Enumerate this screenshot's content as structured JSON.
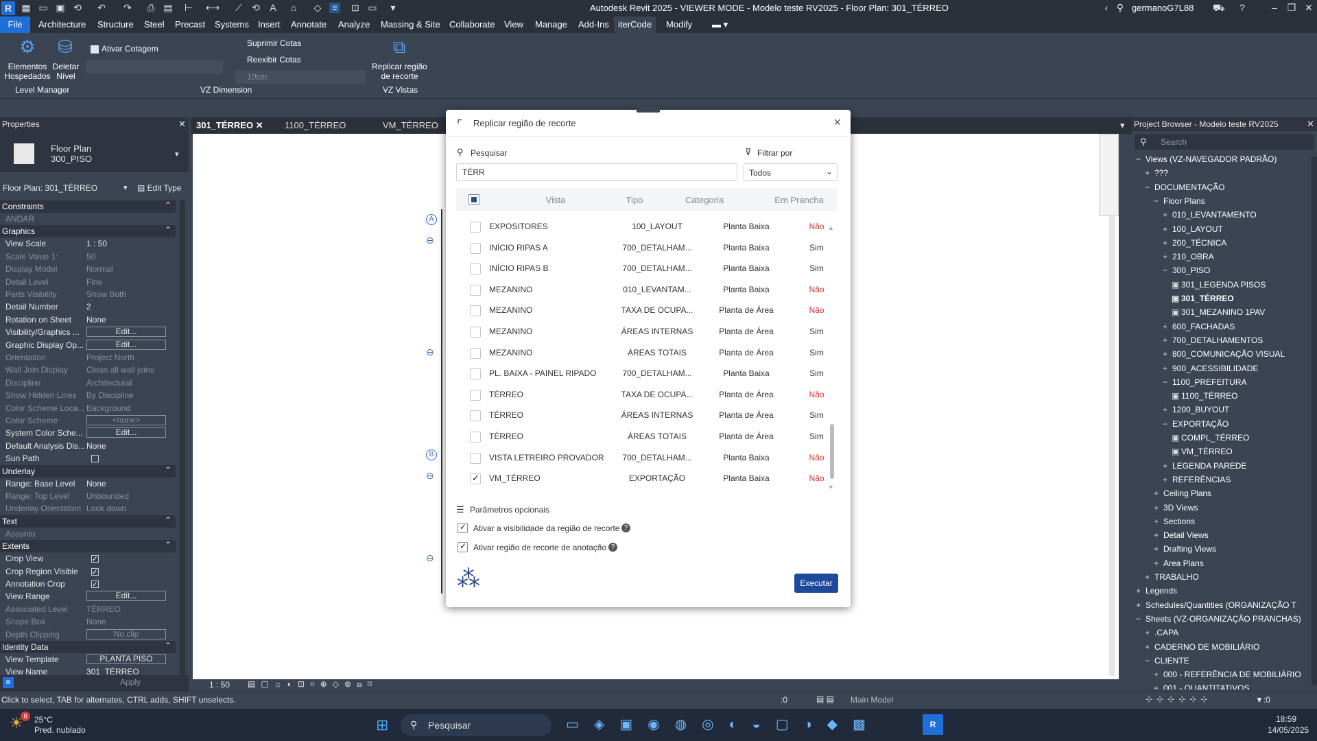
{
  "app": {
    "title": "Autodesk Revit 2025 - VIEWER MODE - Modelo teste RV2025 - Floor Plan: 301_TÉRREO",
    "user": "germanoG7L88"
  },
  "menu": [
    "File",
    "Architecture",
    "Structure",
    "Steel",
    "Precast",
    "Systems",
    "Insert",
    "Annotate",
    "Analyze",
    "Massing & Site",
    "Collaborate",
    "View",
    "Manage",
    "Add-Ins",
    "iterCode",
    "Modify"
  ],
  "ribbon": {
    "elementos": "Elementos\nHospedados",
    "deletar": "Deletar\nNível",
    "ativar": "Ativar Cotagem",
    "suprimir": "Suprimir Cotas",
    "reexibir": "Reexibir Cotas",
    "size": "10cm",
    "replicar": "Replicar região\nde recorte",
    "groups": {
      "level": "Level Manager",
      "dim": "VZ Dimension",
      "vistas": "VZ Vistas"
    }
  },
  "properties": {
    "title": "Properties",
    "type": "Floor Plan",
    "subtype": "300_PISO",
    "selector": "Floor Plan: 301_TÉRREO",
    "edit_type": "Edit Type",
    "apply": "Apply",
    "rows": [
      {
        "k": "Constraints",
        "section": true
      },
      {
        "k": "ANDAR",
        "v": "",
        "dim": true
      },
      {
        "k": "Graphics",
        "section": true
      },
      {
        "k": "View Scale",
        "v": "1 : 50"
      },
      {
        "k": "Scale Value    1:",
        "v": "50",
        "dim": true
      },
      {
        "k": "Display Model",
        "v": "Normal",
        "dim": true
      },
      {
        "k": "Detail Level",
        "v": "Fine",
        "dim": true
      },
      {
        "k": "Parts Visibility",
        "v": "Show Both",
        "dim": true
      },
      {
        "k": "Detail Number",
        "v": "2"
      },
      {
        "k": "Rotation on Sheet",
        "v": "None"
      },
      {
        "k": "Visibility/Graphics ...",
        "v": "Edit...",
        "btn": true
      },
      {
        "k": "Graphic Display Op...",
        "v": "Edit...",
        "btn": true
      },
      {
        "k": "Orientation",
        "v": "Project North",
        "dim": true
      },
      {
        "k": "Wall Join Display",
        "v": "Clean all wall joins",
        "dim": true
      },
      {
        "k": "Discipline",
        "v": "Architectural",
        "dim": true
      },
      {
        "k": "Show Hidden Lines",
        "v": "By Discipline",
        "dim": true
      },
      {
        "k": "Color Scheme Loca...",
        "v": "Background",
        "dim": true
      },
      {
        "k": "Color Scheme",
        "v": "<none>",
        "btn": true,
        "dim": true
      },
      {
        "k": "System Color Sche...",
        "v": "Edit...",
        "btn": true
      },
      {
        "k": "Default Analysis Dis...",
        "v": "None"
      },
      {
        "k": "Sun Path",
        "v": "",
        "cb": false
      },
      {
        "k": "Underlay",
        "section": true
      },
      {
        "k": "Range: Base Level",
        "v": "None"
      },
      {
        "k": "Range: Top Level",
        "v": "Unbounded",
        "dim": true
      },
      {
        "k": "Underlay Orientation",
        "v": "Look down",
        "dim": true
      },
      {
        "k": "Text",
        "section": true
      },
      {
        "k": "Assunto",
        "v": "",
        "dim": true
      },
      {
        "k": "Extents",
        "section": true
      },
      {
        "k": "Crop View",
        "v": "",
        "cb": true
      },
      {
        "k": "Crop Region Visible",
        "v": "",
        "cb": true
      },
      {
        "k": "Annotation Crop",
        "v": "",
        "cb": true
      },
      {
        "k": "View Range",
        "v": "Edit...",
        "btn": true
      },
      {
        "k": "Associated Level",
        "v": "TÉRREO",
        "dim": true
      },
      {
        "k": "Scope Box",
        "v": "None",
        "dim": true
      },
      {
        "k": "Depth Clipping",
        "v": "No clip",
        "btn": true,
        "dim": true
      },
      {
        "k": "Identity Data",
        "section": true
      },
      {
        "k": "View Template",
        "v": "PLANTA PISO",
        "btn": true
      },
      {
        "k": "View Name",
        "v": "301_TÉRREO"
      }
    ]
  },
  "tabs": [
    "301_TÉRREO",
    "1100_TÉRREO",
    "VM_TÉRREO"
  ],
  "dialog": {
    "title": "Replicar região de recorte",
    "search_label": "Pesquisar",
    "search_value": "TÉRR",
    "filter_label": "Filtrar por",
    "filter_value": "Todos",
    "headers": [
      "Vista",
      "Tipo",
      "Categoria",
      "Em Prancha"
    ],
    "rows": [
      {
        "vista": "EXPOSITORES",
        "tipo": "100_LAYOUT",
        "cat": "Planta Baixa",
        "pr": "Não",
        "checked": false
      },
      {
        "vista": "INÍCIO RIPAS A",
        "tipo": "700_DETALHAM...",
        "cat": "Planta Baixa",
        "pr": "Sim",
        "checked": false
      },
      {
        "vista": "INÍCIO RIPAS B",
        "tipo": "700_DETALHAM...",
        "cat": "Planta Baixa",
        "pr": "Sim",
        "checked": false
      },
      {
        "vista": "MEZANINO",
        "tipo": "010_LEVANTAM...",
        "cat": "Planta Baixa",
        "pr": "Não",
        "checked": false
      },
      {
        "vista": "MEZANINO",
        "tipo": "TAXA DE OCUPA...",
        "cat": "Planta de Área",
        "pr": "Não",
        "checked": false
      },
      {
        "vista": "MEZANINO",
        "tipo": "ÁREAS INTERNAS",
        "cat": "Planta de Área",
        "pr": "Sim",
        "checked": false
      },
      {
        "vista": "MEZANINO",
        "tipo": "ÁREAS TOTAIS",
        "cat": "Planta de Área",
        "pr": "Sim",
        "checked": false
      },
      {
        "vista": "PL. BAIXA - PAINEL RIPADO",
        "tipo": "700_DETALHAM...",
        "cat": "Planta Baixa",
        "pr": "Sim",
        "checked": false
      },
      {
        "vista": "TÉRREO",
        "tipo": "TAXA DE OCUPA...",
        "cat": "Planta de Área",
        "pr": "Não",
        "checked": false
      },
      {
        "vista": "TÉRREO",
        "tipo": "ÁREAS INTERNAS",
        "cat": "Planta de Área",
        "pr": "Sim",
        "checked": false
      },
      {
        "vista": "TÉRREO",
        "tipo": "ÁREAS TOTAIS",
        "cat": "Planta de Área",
        "pr": "Sim",
        "checked": false
      },
      {
        "vista": "VISTA LETREIRO PROVADOR",
        "tipo": "700_DETALHAM...",
        "cat": "Planta Baixa",
        "pr": "Não",
        "checked": false
      },
      {
        "vista": "VM_TÉRREO",
        "tipo": "EXPORTAÇÃO",
        "cat": "Planta Baixa",
        "pr": "Não",
        "checked": true
      }
    ],
    "optional_label": "Parâmetros opcionais",
    "opt1": "Ativar a visibilidade da região de recorte",
    "opt2": "Ativar região de recorte de anotação",
    "run": "Executar"
  },
  "browser": {
    "title": "Project Browser - Modelo teste RV2025",
    "search_placeholder": "Search",
    "items": [
      {
        "t": "Views (VZ-NAVEGADOR PADRÃO)",
        "lvl": 0,
        "pm": "−"
      },
      {
        "t": "???",
        "lvl": 1,
        "pm": "+"
      },
      {
        "t": "DOCUMENTAÇÃO",
        "lvl": 1,
        "pm": "−"
      },
      {
        "t": "Floor Plans",
        "lvl": 2,
        "pm": "−"
      },
      {
        "t": "010_LEVANTAMENTO",
        "lvl": 3,
        "pm": "+"
      },
      {
        "t": "100_LAYOUT",
        "lvl": 3,
        "pm": "+"
      },
      {
        "t": "200_TÉCNICA",
        "lvl": 3,
        "pm": "+"
      },
      {
        "t": "210_OBRA",
        "lvl": 3,
        "pm": "+"
      },
      {
        "t": "300_PISO",
        "lvl": 3,
        "pm": "−"
      },
      {
        "t": "301_LEGENDA PISOS",
        "lvl": 4,
        "pm": ""
      },
      {
        "t": "301_TÉRREO",
        "lvl": 4,
        "pm": "",
        "bold": true
      },
      {
        "t": "301_MEZANINO 1PAV",
        "lvl": 4,
        "pm": ""
      },
      {
        "t": "600_FACHADAS",
        "lvl": 3,
        "pm": "+"
      },
      {
        "t": "700_DETALHAMENTOS",
        "lvl": 3,
        "pm": "+"
      },
      {
        "t": "800_COMUNICAÇÃO VISUAL",
        "lvl": 3,
        "pm": "+"
      },
      {
        "t": "900_ACESSIBILIDADE",
        "lvl": 3,
        "pm": "+"
      },
      {
        "t": "1100_PREFEITURA",
        "lvl": 3,
        "pm": "−"
      },
      {
        "t": "1100_TÉRREO",
        "lvl": 4,
        "pm": ""
      },
      {
        "t": "1200_BUYOUT",
        "lvl": 3,
        "pm": "+"
      },
      {
        "t": "EXPORTAÇÃO",
        "lvl": 3,
        "pm": "−"
      },
      {
        "t": "COMPL_TÉRREO",
        "lvl": 4,
        "pm": ""
      },
      {
        "t": "VM_TÉRREO",
        "lvl": 4,
        "pm": ""
      },
      {
        "t": "LEGENDA PAREDE",
        "lvl": 3,
        "pm": "+"
      },
      {
        "t": "REFERÊNCIAS",
        "lvl": 3,
        "pm": "+"
      },
      {
        "t": "Ceiling Plans",
        "lvl": 2,
        "pm": "+"
      },
      {
        "t": "3D Views",
        "lvl": 2,
        "pm": "+"
      },
      {
        "t": "Sections",
        "lvl": 2,
        "pm": "+"
      },
      {
        "t": "Detail Views",
        "lvl": 2,
        "pm": "+"
      },
      {
        "t": "Drafting Views",
        "lvl": 2,
        "pm": "+"
      },
      {
        "t": "Area Plans",
        "lvl": 2,
        "pm": "+"
      },
      {
        "t": "TRABALHO",
        "lvl": 1,
        "pm": "+"
      },
      {
        "t": "Legends",
        "lvl": 0,
        "pm": "+"
      },
      {
        "t": "Schedules/Quantities (ORGANIZAÇÃO T",
        "lvl": 0,
        "pm": "+"
      },
      {
        "t": "Sheets (VZ-ORGANIZAÇÃO PRANCHAS)",
        "lvl": 0,
        "pm": "−"
      },
      {
        "t": ".CAPA",
        "lvl": 1,
        "pm": "+"
      },
      {
        "t": "CADERNO DE MOBILIÁRIO",
        "lvl": 1,
        "pm": "+"
      },
      {
        "t": "CLIENTE",
        "lvl": 1,
        "pm": "−"
      },
      {
        "t": "000 - REFERÊNCIA DE MOBILIÁRIO",
        "lvl": 2,
        "pm": "+"
      },
      {
        "t": "001 - QUANTITATIVOS",
        "lvl": 2,
        "pm": "+"
      }
    ]
  },
  "viewctl": {
    "scale": "1 : 50"
  },
  "status": {
    "hint": "Click to select, TAB for alternates, CTRL adds, SHIFT unselects.",
    "zero": ":0",
    "model": "Main Model",
    "filter": ":0"
  },
  "taskbar": {
    "temp": "25°C",
    "weather": "Pred. nublado",
    "search": "Pesquisar",
    "time": "18:59",
    "date": "14/05/2025",
    "badge": "8"
  }
}
